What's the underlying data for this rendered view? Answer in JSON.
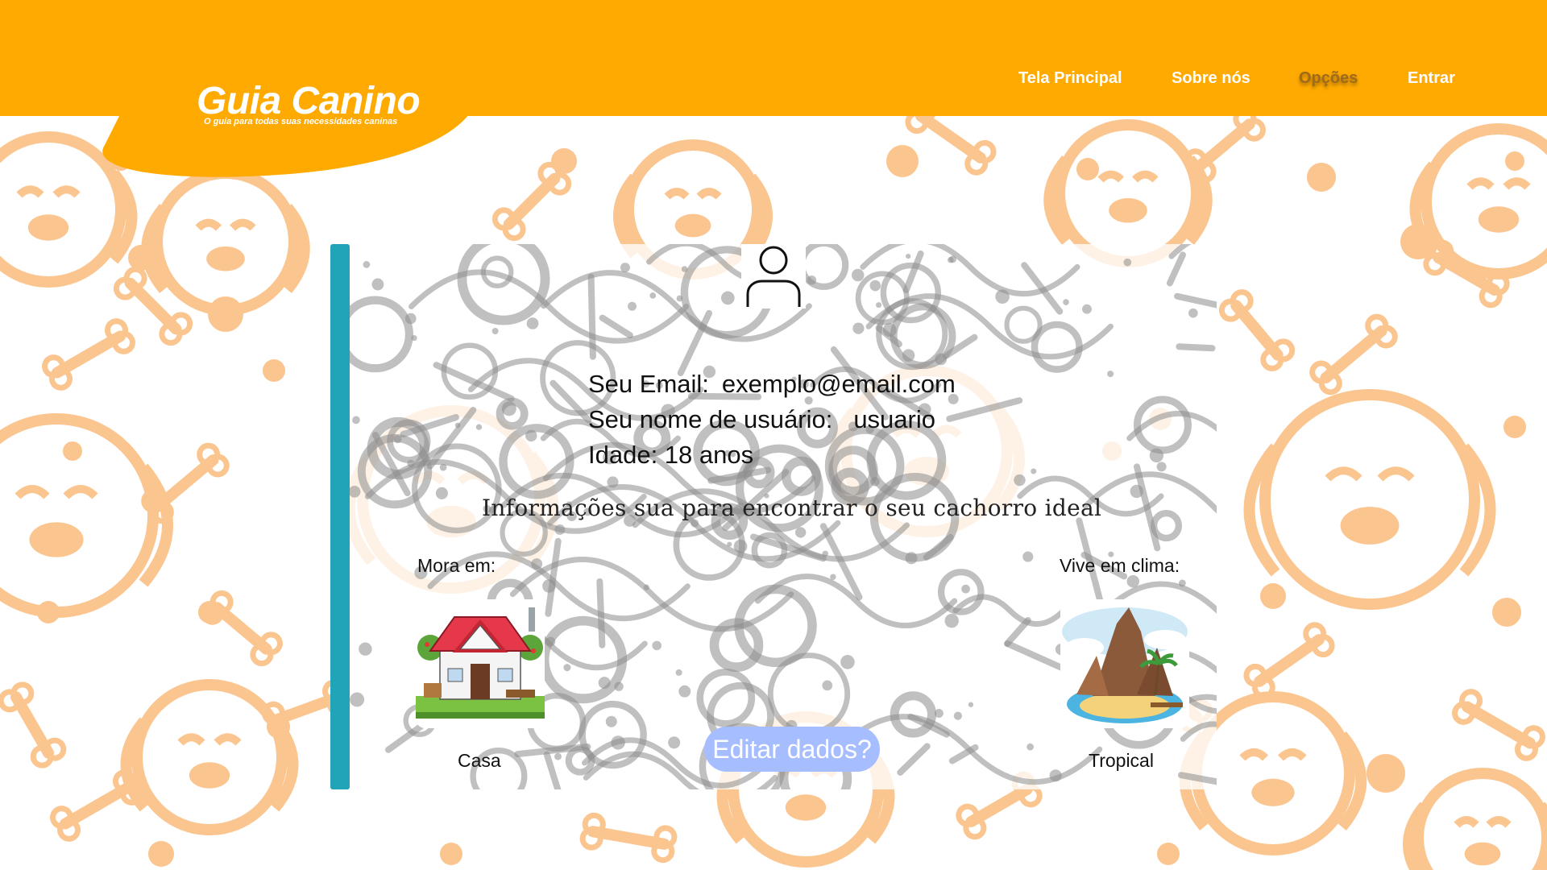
{
  "brand": {
    "title": "Guia Canino",
    "subtitle": "O guia para todas suas necessidades caninas"
  },
  "nav": {
    "items": [
      "Tela Principal",
      "Sobre nós",
      "Opções",
      "Entrar"
    ],
    "active": "Opções"
  },
  "profile": {
    "email_label": "Seu Email:",
    "email_value": "exemplo@email.com",
    "username_label": "Seu nome de usuário:",
    "username_value": "usuario",
    "age_text": "Idade: 18 anos",
    "avatar_icon": "user-icon"
  },
  "preferences": {
    "heading": "Informações sua para encontrar o seu cachorro ideal",
    "housing_label": "Mora em:",
    "housing_value": "Casa",
    "housing_icon": "house-illustration",
    "climate_label": "Vive em clima:",
    "climate_value": "Tropical",
    "climate_icon": "tropical-island-illustration"
  },
  "actions": {
    "edit_label": "Editar dados?"
  },
  "colors": {
    "header": "#FFAA00",
    "accent_bar": "#21A4B8",
    "button": "#A6BDFF",
    "pattern": "#FBC58F"
  }
}
